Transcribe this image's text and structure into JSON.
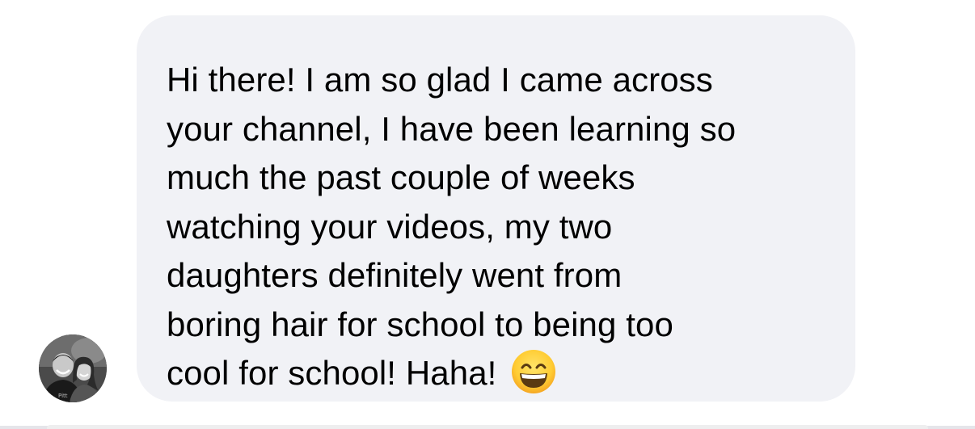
{
  "message": {
    "lines": [
      "Hi there! I am so glad I came across",
      "your channel, I have been learning so",
      "much the past couple of weeks",
      "watching your videos, my two",
      "daughters definitely went from",
      "boring hair for school to being too",
      "cool for school! Haha!"
    ],
    "emoji": "grinning-face-with-smiling-eyes"
  },
  "sender": {
    "avatar_icon": "profile-photo"
  },
  "colors": {
    "bubble_background": "#f1f2f6",
    "text": "#000000",
    "page_background": "#ffffff"
  }
}
